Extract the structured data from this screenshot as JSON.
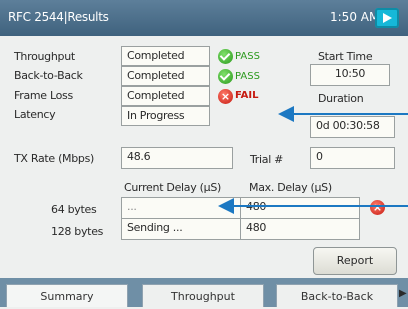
{
  "window": {
    "title": "RFC 2544|Results",
    "clock": "1:50 AM"
  },
  "tests": [
    {
      "label": "Throughput",
      "status": "Completed",
      "result": "PASS",
      "result_type": "pass"
    },
    {
      "label": "Back-to-Back",
      "status": "Completed",
      "result": "PASS",
      "result_type": "pass"
    },
    {
      "label": "Frame Loss",
      "status": "Completed",
      "result": "FAIL",
      "result_type": "fail"
    },
    {
      "label": "Latency",
      "status": "In Progress"
    }
  ],
  "start_time": {
    "label": "Start Time",
    "value": "10:50"
  },
  "duration": {
    "label": "Duration",
    "value": "0d 00:30:58"
  },
  "tx_rate": {
    "label": "TX Rate (Mbps)",
    "value": "48.6"
  },
  "trial": {
    "label": "Trial #",
    "value": "0"
  },
  "delay": {
    "current_header": "Current Delay (µS)",
    "max_header": "Max. Delay (µS)",
    "rows": [
      {
        "size": "64 bytes",
        "current": "...",
        "max": "480"
      },
      {
        "size": "128 bytes",
        "current": "Sending ...",
        "max": "480"
      }
    ]
  },
  "report_button": "Report",
  "tabs": [
    "Summary",
    "Throughput",
    "Back-to-Back"
  ],
  "colors": {
    "titlebar": "#4a6d88",
    "pass": "#2c9a1e",
    "fail": "#c61a10",
    "arrow": "#1c78c2"
  }
}
